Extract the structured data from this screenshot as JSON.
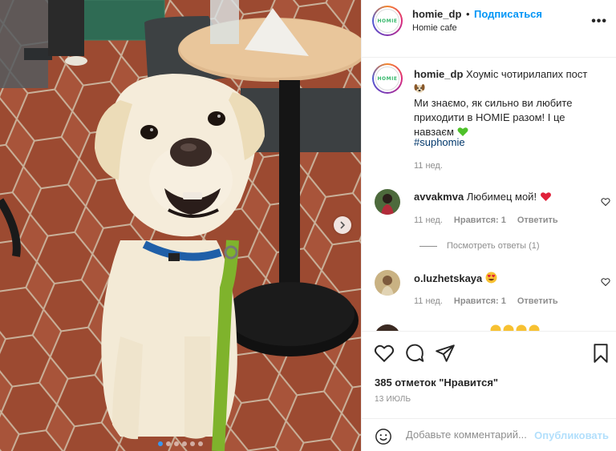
{
  "post": {
    "username": "homie_dp",
    "separator": "•",
    "follow_label": "Подписаться",
    "location": "Homie cafe",
    "more_label": "•••",
    "avatar_logo_text": "HOMIE",
    "caption_username": "homie_dp",
    "caption_text": "Хоуміс чотирилапих пост",
    "caption_line2": "Ми знаємо, як сильно ви любите приходити в HOMIE разом! І це навзаєм",
    "hashtag": "#suphomie",
    "caption_time": "11 нед.",
    "likes": "385 отметок \"Нравится\"",
    "date": "13 ИЮЛЬ",
    "carousel_total": 6,
    "carousel_active": 1
  },
  "comments": [
    {
      "username": "avvakmva",
      "text": "Любимец мой!",
      "time": "11 нед.",
      "likes": "Нравится: 1",
      "reply": "Ответить",
      "view_replies": "Посмотреть ответы (1)",
      "emoji": "red-heart"
    },
    {
      "username": "o.luzhetskaya",
      "text": "",
      "time": "11 нед.",
      "likes": "Нравится: 1",
      "reply": "Ответить",
      "emoji": "heart-eyes"
    }
  ],
  "composer": {
    "placeholder": "Добавьте комментарий...",
    "submit_label": "Опубликовать"
  },
  "colors": {
    "accent": "#0095f6",
    "hashtag": "#00376b",
    "muted": "#8e8e8e",
    "logo_green": "#37b86c",
    "post_disabled": "#b2dffc",
    "carousel_dot_active": "#3897f0"
  }
}
